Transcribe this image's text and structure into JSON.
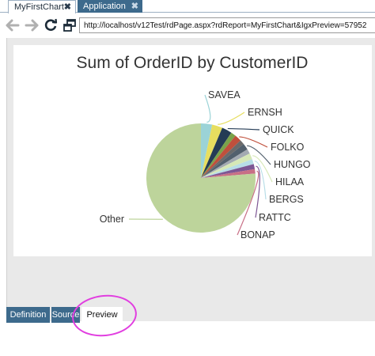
{
  "tabs": [
    {
      "label": "MyFirstChart",
      "active": true
    },
    {
      "label": "Application",
      "active": false
    }
  ],
  "nav": {
    "url": "http://localhost/v12Test/rdPage.aspx?rdReport=MyFirstChart&IgxPreview=57952"
  },
  "bottom_tabs": [
    {
      "label": "Definition"
    },
    {
      "label": "Source"
    },
    {
      "label": "Preview",
      "selected": true
    }
  ],
  "colors": {
    "tab_blue": "#3d6a8c",
    "highlight": "#e13ee0"
  },
  "chart_data": {
    "type": "pie",
    "title": "Sum of OrderID by CustomerID",
    "slices": [
      {
        "label": "SAVEA",
        "value": 3.3,
        "color": "#9bd3d7"
      },
      {
        "label": "ERNSH",
        "value": 3.1,
        "color": "#e7de5f"
      },
      {
        "label": "QUICK",
        "value": 3.0,
        "color": "#243b55"
      },
      {
        "label": "",
        "value": 1.5,
        "color": "#7aa34a"
      },
      {
        "label": "FOLKO",
        "value": 2.0,
        "color": "#c0503c"
      },
      {
        "label": "",
        "value": 1.4,
        "color": "#6a6a6a"
      },
      {
        "label": "HUNGO",
        "value": 1.9,
        "color": "#52606d"
      },
      {
        "label": "",
        "value": 1.4,
        "color": "#a3aab2"
      },
      {
        "label": "HILAA",
        "value": 1.8,
        "color": "#d6e8b7"
      },
      {
        "label": "BERGS",
        "value": 1.5,
        "color": "#b7dde7"
      },
      {
        "label": "RATTC",
        "value": 1.5,
        "color": "#7d5694"
      },
      {
        "label": "BONAP",
        "value": 1.3,
        "color": "#c86f86"
      },
      {
        "label": "Other",
        "value": 76.3,
        "color": "#bdd49b"
      }
    ]
  }
}
